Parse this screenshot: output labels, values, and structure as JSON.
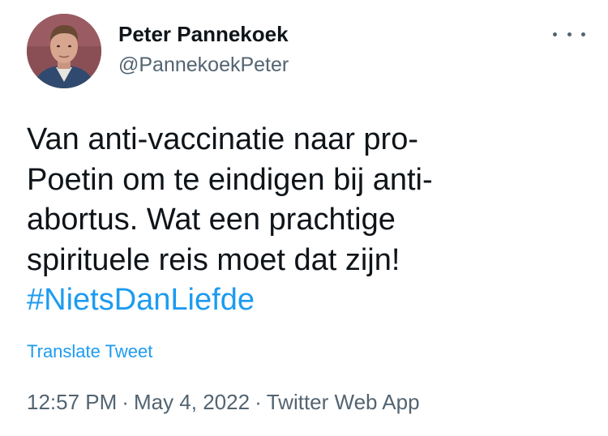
{
  "author": {
    "display_name": "Peter Pannekoek",
    "handle": "@PannekoekPeter"
  },
  "tweet": {
    "text_lines": [
      "Van anti-vaccinatie naar pro-",
      "Poetin om te eindigen bij anti-",
      "abortus. Wat een prachtige",
      "spirituele reis moet dat zijn!"
    ],
    "hashtag": "#NietsDanLiefde",
    "translate_label": "Translate Tweet"
  },
  "meta": {
    "time": "12:57 PM",
    "separator": "·",
    "date": "May 4, 2022",
    "source": "Twitter Web App"
  },
  "icons": {
    "more": "more-horizontal-icon",
    "avatar": "profile-photo"
  },
  "colors": {
    "text": "#0f1419",
    "secondary": "#536471",
    "link": "#1d9bf0",
    "background": "#ffffff"
  }
}
